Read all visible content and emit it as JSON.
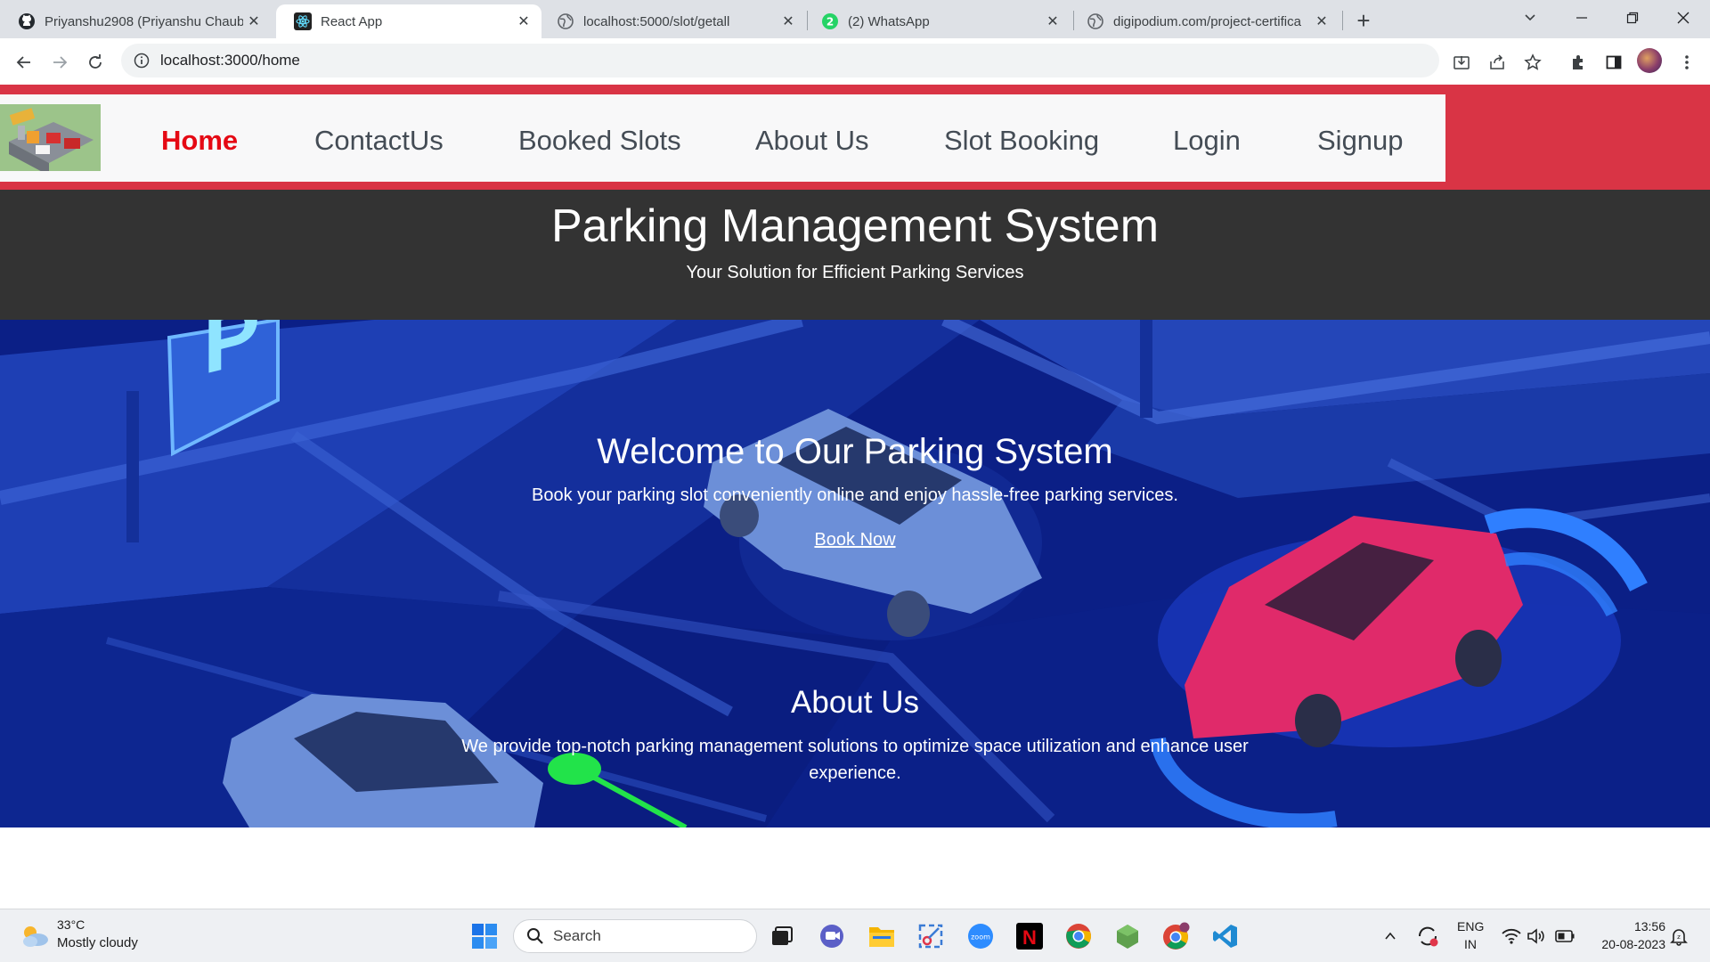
{
  "browser": {
    "tabs": [
      {
        "title": "Priyanshu2908 (Priyanshu Chaube",
        "icon": "github-icon",
        "active": false
      },
      {
        "title": "React App",
        "icon": "react-icon",
        "active": true
      },
      {
        "title": "localhost:5000/slot/getall",
        "icon": "globe-icon",
        "active": false
      },
      {
        "title": "(2) WhatsApp",
        "icon": "whatsapp-icon",
        "active": false
      },
      {
        "title": "digipodium.com/project-certifica",
        "icon": "globe-icon",
        "active": false
      }
    ],
    "url": "localhost:3000/home"
  },
  "nav": {
    "links": [
      "Home",
      "ContactUs",
      "Booked Slots",
      "About Us",
      "Slot Booking",
      "Login",
      "Signup"
    ],
    "active_color": "#e50914",
    "accent_color": "#d93445"
  },
  "header": {
    "title": "Parking Management System",
    "subtitle": "Your Solution for Efficient Parking Services"
  },
  "hero": {
    "welcome_title": "Welcome to Our Parking System",
    "welcome_text": "Book your parking slot conveniently online and enjoy hassle-free parking services.",
    "cta_label": "Book Now",
    "about_title": "About Us",
    "about_text": "We provide top-notch parking management solutions to optimize space utilization and enhance user experience."
  },
  "taskbar": {
    "weather_temp": "33°C",
    "weather_desc": "Mostly cloudy",
    "search_label": "Search",
    "lang_line1": "ENG",
    "lang_line2": "IN",
    "time": "13:56",
    "date": "20-08-2023"
  }
}
